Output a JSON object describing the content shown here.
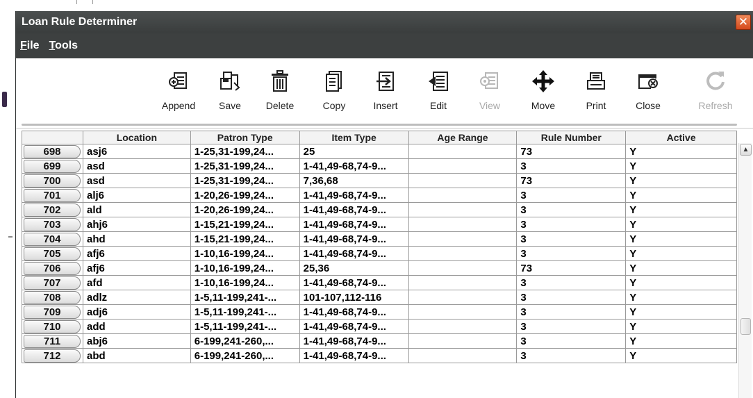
{
  "window": {
    "title": "Loan Rule Determiner",
    "close_glyph": "✕"
  },
  "menu": {
    "items": [
      {
        "key": "F",
        "rest": "ile"
      },
      {
        "key": "T",
        "rest": "ools"
      }
    ]
  },
  "toolbar": {
    "tools": [
      {
        "label": "Append",
        "icon": "append-icon",
        "enabled": true
      },
      {
        "label": "Save",
        "icon": "save-icon",
        "enabled": true
      },
      {
        "label": "Delete",
        "icon": "trash-icon",
        "enabled": true
      },
      {
        "label": "Copy",
        "icon": "copy-icon",
        "enabled": true
      },
      {
        "label": "Insert",
        "icon": "insert-icon",
        "enabled": true
      },
      {
        "label": "Edit",
        "icon": "edit-icon",
        "enabled": true
      },
      {
        "label": "View",
        "icon": "view-icon",
        "enabled": false
      },
      {
        "label": "Move",
        "icon": "move-icon",
        "enabled": true
      },
      {
        "label": "Print",
        "icon": "printer-icon",
        "enabled": true
      },
      {
        "label": "Close",
        "icon": "close-window-icon",
        "enabled": true
      },
      {
        "label": "Refresh",
        "icon": "refresh-icon",
        "enabled": false
      }
    ]
  },
  "table": {
    "columns": [
      "",
      "Location",
      "Patron Type",
      "Item Type",
      "Age Range",
      "Rule Number",
      "Active"
    ],
    "rows": [
      {
        "num": "698",
        "location": "asj6",
        "patron": "1-25,31-199,24...",
        "item": "25",
        "age": "",
        "rule": "73",
        "active": "Y"
      },
      {
        "num": "699",
        "location": "asd",
        "patron": "1-25,31-199,24...",
        "item": "1-41,49-68,74-9...",
        "age": "",
        "rule": "3",
        "active": "Y"
      },
      {
        "num": "700",
        "location": "asd",
        "patron": "1-25,31-199,24...",
        "item": "7,36,68",
        "age": "",
        "rule": "73",
        "active": "Y"
      },
      {
        "num": "701",
        "location": "alj6",
        "patron": "1-20,26-199,24...",
        "item": "1-41,49-68,74-9...",
        "age": "",
        "rule": "3",
        "active": "Y"
      },
      {
        "num": "702",
        "location": "ald",
        "patron": "1-20,26-199,24...",
        "item": "1-41,49-68,74-9...",
        "age": "",
        "rule": "3",
        "active": "Y"
      },
      {
        "num": "703",
        "location": "ahj6",
        "patron": "1-15,21-199,24...",
        "item": "1-41,49-68,74-9...",
        "age": "",
        "rule": "3",
        "active": "Y"
      },
      {
        "num": "704",
        "location": "ahd",
        "patron": "1-15,21-199,24...",
        "item": "1-41,49-68,74-9...",
        "age": "",
        "rule": "3",
        "active": "Y"
      },
      {
        "num": "705",
        "location": "afj6",
        "patron": "1-10,16-199,24...",
        "item": "1-41,49-68,74-9...",
        "age": "",
        "rule": "3",
        "active": "Y"
      },
      {
        "num": "706",
        "location": "afj6",
        "patron": "1-10,16-199,24...",
        "item": "25,36",
        "age": "",
        "rule": "73",
        "active": "Y"
      },
      {
        "num": "707",
        "location": "afd",
        "patron": "1-10,16-199,24...",
        "item": "1-41,49-68,74-9...",
        "age": "",
        "rule": "3",
        "active": "Y"
      },
      {
        "num": "708",
        "location": "adlz",
        "patron": "1-5,11-199,241-...",
        "item": "101-107,112-116",
        "age": "",
        "rule": "3",
        "active": "Y"
      },
      {
        "num": "709",
        "location": "adj6",
        "patron": "1-5,11-199,241-...",
        "item": "1-41,49-68,74-9...",
        "age": "",
        "rule": "3",
        "active": "Y"
      },
      {
        "num": "710",
        "location": "add",
        "patron": "1-5,11-199,241-...",
        "item": "1-41,49-68,74-9...",
        "age": "",
        "rule": "3",
        "active": "Y"
      },
      {
        "num": "711",
        "location": "abj6",
        "patron": "6-199,241-260,...",
        "item": "1-41,49-68,74-9...",
        "age": "",
        "rule": "3",
        "active": "Y"
      },
      {
        "num": "712",
        "location": "abd",
        "patron": "6-199,241-260,...",
        "item": "1-41,49-68,74-9...",
        "age": "",
        "rule": "3",
        "active": "Y"
      }
    ]
  },
  "scrollbar": {
    "up_glyph": "▲"
  }
}
